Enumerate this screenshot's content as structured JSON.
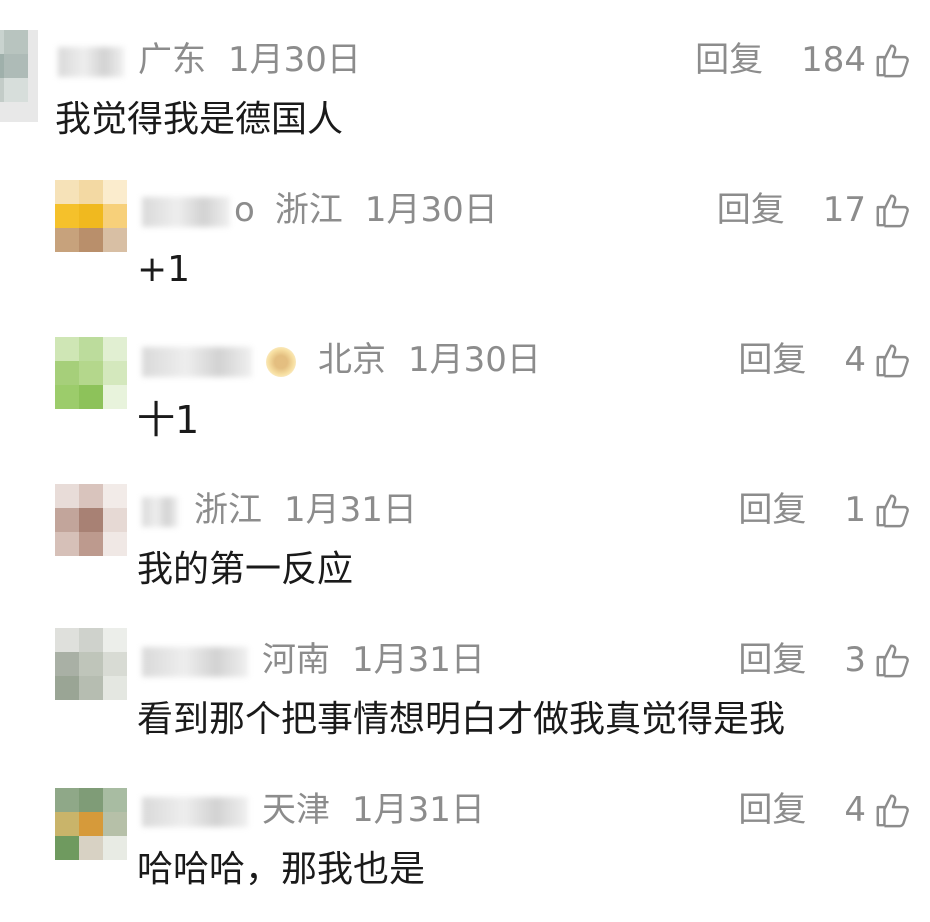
{
  "comments": [
    {
      "username": "广东",
      "username_partial": "广茂",
      "region": "广东",
      "date": "1月30日",
      "reply_label": "回复",
      "likes": "184",
      "text": "我觉得我是德国人"
    },
    {
      "username_partial": "o",
      "region": "浙江",
      "date": "1月30日",
      "reply_label": "回复",
      "likes": "17",
      "text": "+1"
    },
    {
      "username_partial": "",
      "region": "北京",
      "date": "1月30日",
      "reply_label": "回复",
      "likes": "4",
      "text": "十1"
    },
    {
      "username_partial": "",
      "region": "浙江",
      "date": "1月31日",
      "reply_label": "回复",
      "likes": "1",
      "text": "我的第一反应"
    },
    {
      "username_partial": "",
      "region": "河南",
      "date": "1月31日",
      "reply_label": "回复",
      "likes": "3",
      "text": "看到那个把事情想明白才做我真觉得是我"
    },
    {
      "username_partial": "",
      "region": "天津",
      "date": "1月31日",
      "reply_label": "回复",
      "likes": "4",
      "text": "哈哈哈，那我也是"
    }
  ],
  "icons": {
    "like": "thumbs-up-icon"
  },
  "colors": {
    "meta": "#8c8c8c",
    "text": "#1a1a1a"
  }
}
